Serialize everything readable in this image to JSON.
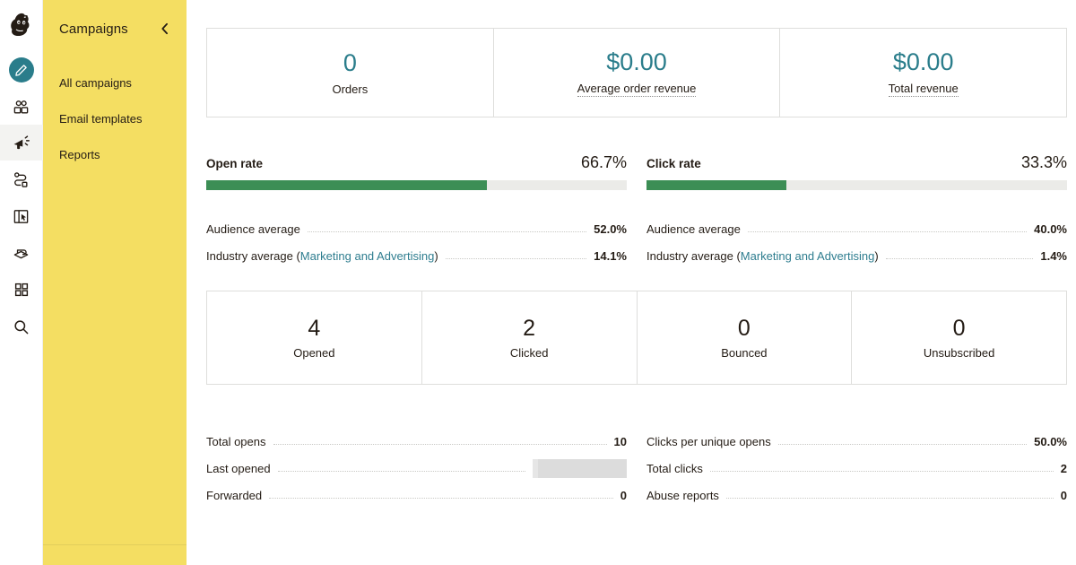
{
  "brand": {
    "accent_teal": "#2a7d8b",
    "panel_yellow": "#f4de62",
    "bar_green": "#3c8e55",
    "link_teal": "#2e7d8f"
  },
  "rail": {
    "logo": "mailchimp-freddie-logo",
    "items": [
      {
        "name": "create-icon",
        "label": "Create"
      },
      {
        "name": "audience-icon",
        "label": "Audience"
      },
      {
        "name": "campaigns-megaphone-icon",
        "label": "Campaigns",
        "active": true
      },
      {
        "name": "automations-icon",
        "label": "Automations"
      },
      {
        "name": "landing-pages-icon",
        "label": "Landing pages"
      },
      {
        "name": "website-icon",
        "label": "Website"
      },
      {
        "name": "integrations-grid-icon",
        "label": "Integrations"
      },
      {
        "name": "search-icon",
        "label": "Search"
      }
    ]
  },
  "nav": {
    "title": "Campaigns",
    "collapse_icon": "chevron-left-icon",
    "items": [
      {
        "label": "All campaigns"
      },
      {
        "label": "Email templates"
      },
      {
        "label": "Reports"
      }
    ]
  },
  "revenue_cards": [
    {
      "value": "0",
      "label": "Orders",
      "tooltip": false
    },
    {
      "value": "$0.00",
      "label": "Average order revenue",
      "tooltip": true
    },
    {
      "value": "$0.00",
      "label": "Total revenue",
      "tooltip": true
    }
  ],
  "rates": [
    {
      "name": "Open rate",
      "percent_label": "66.7%",
      "percent_value": 66.7,
      "rows": [
        {
          "label": "Audience average",
          "value": "52.0%"
        },
        {
          "label_prefix": "Industry average (",
          "link": "Marketing and Advertising",
          "label_suffix": ")",
          "value": "14.1%"
        }
      ]
    },
    {
      "name": "Click rate",
      "percent_label": "33.3%",
      "percent_value": 33.3,
      "rows": [
        {
          "label": "Audience average",
          "value": "40.0%"
        },
        {
          "label_prefix": "Industry average (",
          "link": "Marketing and Advertising",
          "label_suffix": ")",
          "value": "1.4%"
        }
      ]
    }
  ],
  "engagement_cards": [
    {
      "value": "4",
      "label": "Opened"
    },
    {
      "value": "2",
      "label": "Clicked"
    },
    {
      "value": "0",
      "label": "Bounced"
    },
    {
      "value": "0",
      "label": "Unsubscribed"
    }
  ],
  "details": {
    "left": [
      {
        "label": "Total opens",
        "value": "10",
        "redacted": false
      },
      {
        "label": "Last opened",
        "value": "",
        "redacted": true
      },
      {
        "label": "Forwarded",
        "value": "0",
        "redacted": false
      }
    ],
    "right": [
      {
        "label": "Clicks per unique opens",
        "value": "50.0%",
        "redacted": false
      },
      {
        "label": "Total clicks",
        "value": "2",
        "redacted": false
      },
      {
        "label": "Abuse reports",
        "value": "0",
        "redacted": false
      }
    ]
  }
}
